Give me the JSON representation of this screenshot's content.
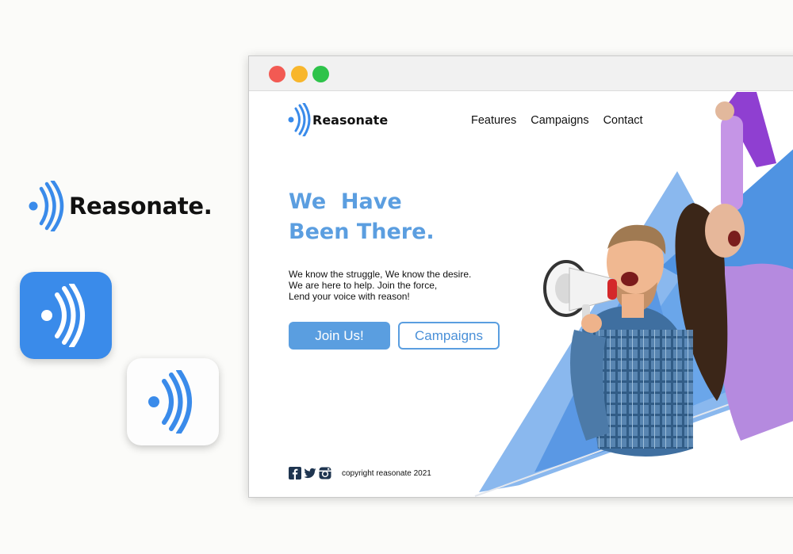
{
  "brand": {
    "name_large": "Reasonate.",
    "name_site": "Reasonate",
    "primary_color": "#3a8bea",
    "secondary_color": "#5a9ee0"
  },
  "icons": {
    "logo_mark": "sound-wave-mark",
    "social": [
      "facebook-icon",
      "twitter-icon",
      "instagram-icon"
    ]
  },
  "nav": {
    "items": [
      "Features",
      "Campaigns",
      "Contact"
    ]
  },
  "hero": {
    "title_lines": [
      "We  Have",
      "Been There."
    ],
    "copy_lines": [
      "We know the struggle, We know the desire.",
      "We are here to help. Join the force,",
      "Lend your voice with reason!"
    ],
    "primary_button": "Join Us!",
    "secondary_button": "Campaigns"
  },
  "footer": {
    "copyright": "copyright reasonate 2021"
  }
}
